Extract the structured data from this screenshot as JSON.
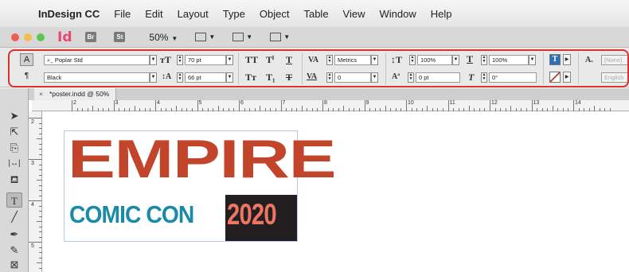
{
  "menu": {
    "app_name": "InDesign CC",
    "items": [
      "File",
      "Edit",
      "Layout",
      "Type",
      "Object",
      "Table",
      "View",
      "Window",
      "Help"
    ]
  },
  "appbar": {
    "logo": "Id",
    "bridge_label": "Br",
    "stock_label": "St",
    "zoom": "50%"
  },
  "control_panel": {
    "font_family": "Poplar Std",
    "font_style": "Black",
    "font_size": "70 pt",
    "leading": "66 pt",
    "kerning": "Metrics",
    "tracking": "0",
    "vertical_scale": "100%",
    "horizontal_scale": "100%",
    "baseline_shift": "0 pt",
    "skew": "0°",
    "char_style": "[None]",
    "language": "English"
  },
  "document": {
    "tab_title": "*poster.indd @ 50%"
  },
  "rulers": {
    "horizontal": [
      "2",
      "3",
      "4",
      "5",
      "6",
      "7",
      "8",
      "9",
      "10",
      "11",
      "12",
      "13",
      "14"
    ],
    "vertical": [
      "2",
      "3",
      "4",
      "5"
    ]
  },
  "poster": {
    "line1": "EMPIRE",
    "line2": "COMIC CON",
    "year": "2020"
  },
  "colors": {
    "empire_red": "#c1442b",
    "comic_teal": "#1a8aa8",
    "year_salmon": "#ee7562",
    "year_bg": "#231f20",
    "highlight": "#d8322c"
  }
}
